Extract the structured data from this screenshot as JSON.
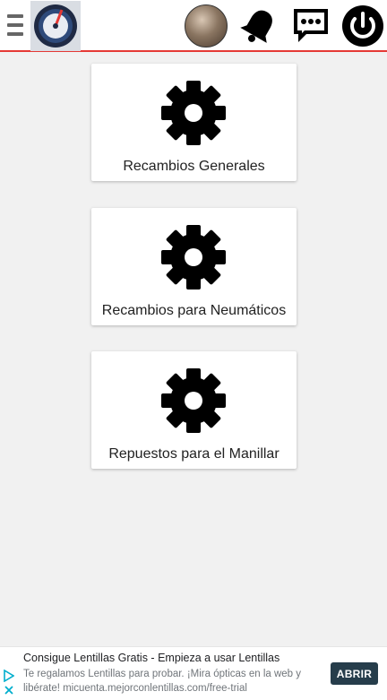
{
  "header": {
    "menu_icon": "menu-icon",
    "logo_icon": "brand-logo",
    "avatar": "user-avatar",
    "notification_icon": "bell-icon",
    "messages_icon": "chat-icon",
    "power_icon": "power-icon",
    "accent_color": "#e53935"
  },
  "categories": [
    {
      "label": "Recambios Generales",
      "icon": "gear-icon"
    },
    {
      "label": "Recambios para Neumáticos",
      "icon": "gear-icon"
    },
    {
      "label": "Repuestos para el Manillar",
      "icon": "gear-icon"
    }
  ],
  "ad": {
    "title": "Consigue Lentillas Gratis - Empieza a usar Lentillas",
    "description": "Te regalamos Lentillas para probar. ¡Mira ópticas en la web y libérate! micuenta.mejorconlentillas.com/free-trial",
    "button_label": "ABRIR",
    "button_color": "#263d4b",
    "adchoices_icon": "play-triangle-icon",
    "close_icon": "close-icon"
  }
}
